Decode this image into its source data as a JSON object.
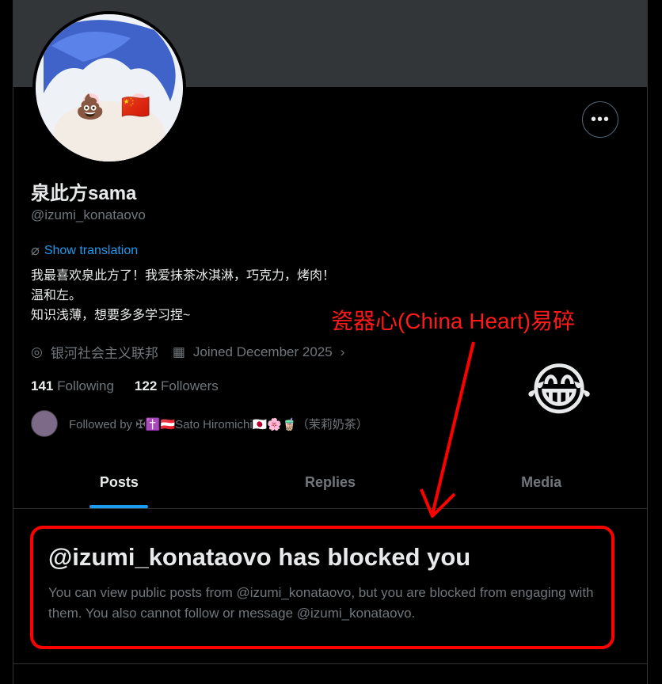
{
  "profile": {
    "name": "泉此方sama",
    "handle": "@izumi_konataovo",
    "translate_label": "Show translation",
    "bio": "我最喜欢泉此方了！我爱抹茶冰淇淋，巧克力，烤肉！\n温和左。\n知识浅薄，想要多多学习捏~",
    "location": "银河社会主义联邦",
    "joined": "Joined December 2025",
    "following_count": "141",
    "following_label": "Following",
    "followers_count": "122",
    "followers_label": "Followers",
    "followed_by": "Followed by ✠✝️🇦🇹Sato Hiromichi🇯🇵🌸🧋（茉莉奶茶）",
    "avatar_emojis": "💩 🇨🇳"
  },
  "tabs": [
    {
      "label": "Posts",
      "active": true
    },
    {
      "label": "Replies",
      "active": false
    },
    {
      "label": "Media",
      "active": false
    }
  ],
  "blocked": {
    "title": "@izumi_konataovo has blocked you",
    "message": "You can view public posts from @izumi_konataovo, but you are blocked from engaging with them. You also cannot follow or message @izumi_konataovo."
  },
  "annotation": {
    "text": "瓷器心(China Heart)易碎",
    "emoji": "😂",
    "color": "#ff0000"
  },
  "icons": {
    "more": "more-icon",
    "translate": "translate-icon",
    "location": "location-icon",
    "calendar": "calendar-icon",
    "chevron": "chevron-right-icon"
  },
  "colors": {
    "accent": "#1d9bf0",
    "muted": "#71767b",
    "text": "#e7e9ea",
    "background": "#000000",
    "banner": "#333639"
  }
}
